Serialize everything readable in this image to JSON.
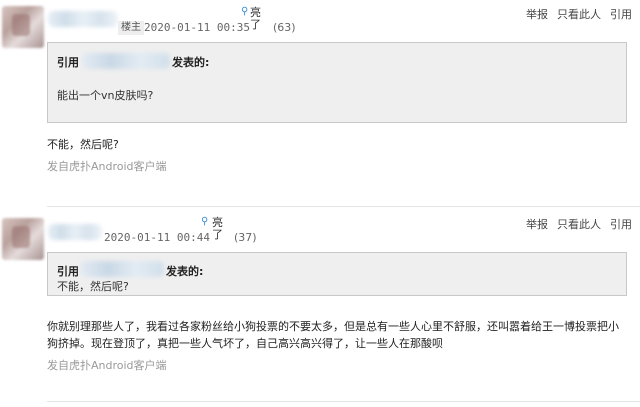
{
  "posts": [
    {
      "badge": "楼主",
      "time": "2020-01-11 00:35",
      "light_icon": "lightbulb-icon",
      "light_label": "亮了",
      "light_count": "(63)",
      "actions": [
        "举报",
        "只看此人",
        "引用"
      ],
      "quote_prefix": "引用",
      "quote_suffix": "发表的:",
      "quote_text": "能出一个vn皮肤吗?",
      "body": "不能，然后呢?",
      "client": "发自虎扑Android客户端"
    },
    {
      "time": "2020-01-11 00:44",
      "light_icon": "lightbulb-icon",
      "light_label": "亮了",
      "light_count": "(37)",
      "actions": [
        "举报",
        "只看此人",
        "引用"
      ],
      "quote_prefix": "引用",
      "quote_suffix": "发表的:",
      "quote_text": "不能，然后呢?",
      "body": "你就别理那些人了，我看过各家粉丝给小狗投票的不要太多，但是总有一些人心里不舒服，还叫嚣着给王一博投票把小狗挤掉。现在登顶了，真把一些人气坏了，自己高兴高兴得了，让一些人在那酸呗",
      "client": "发自虎扑Android客户端"
    }
  ]
}
